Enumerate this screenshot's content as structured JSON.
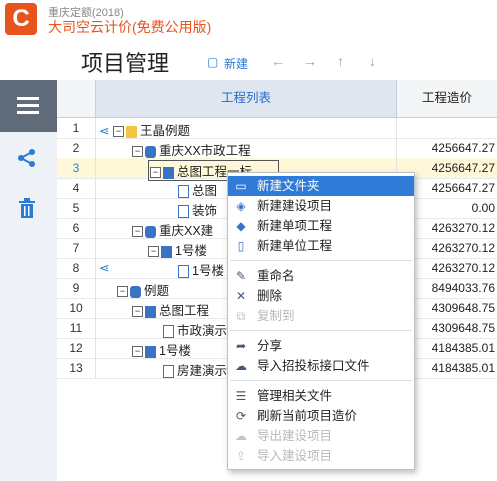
{
  "app": {
    "subtitle": "重庆定额(2018)",
    "title": "大司空云计价(免费公用版)",
    "logo_letter": "C"
  },
  "header": {
    "page_title": "项目管理",
    "new_label": "新建"
  },
  "grid": {
    "col_tree": "工程列表",
    "col_cost": "工程造价",
    "rows": [
      {
        "num": "1",
        "name": "王晶例题",
        "cost": ""
      },
      {
        "num": "2",
        "name": "重庆XX市政工程",
        "cost": "4256647.27"
      },
      {
        "num": "3",
        "name": "总图工程一标",
        "cost": "4256647.27"
      },
      {
        "num": "4",
        "name": "总图",
        "cost": "4256647.27"
      },
      {
        "num": "5",
        "name": "装饰",
        "cost": "0.00"
      },
      {
        "num": "6",
        "name": "重庆XX建",
        "cost": "4263270.12"
      },
      {
        "num": "7",
        "name": "1号楼",
        "cost": "4263270.12"
      },
      {
        "num": "8",
        "name": "1号楼",
        "cost": "4263270.12"
      },
      {
        "num": "9",
        "name": "例题",
        "cost": "8494033.76"
      },
      {
        "num": "10",
        "name": "总图工程",
        "cost": "4309648.75"
      },
      {
        "num": "11",
        "name": "市政演示",
        "cost": "4309648.75"
      },
      {
        "num": "12",
        "name": "1号楼",
        "cost": "4184385.01"
      },
      {
        "num": "13",
        "name": "房建演示",
        "cost": "4184385.01"
      }
    ]
  },
  "context_menu": {
    "items": [
      {
        "label": "新建文件夹",
        "icon": "folder-icon"
      },
      {
        "label": "新建建设项目",
        "icon": "cubes-icon"
      },
      {
        "label": "新建单项工程",
        "icon": "cube-icon"
      },
      {
        "label": "新建单位工程",
        "icon": "file-icon"
      },
      {
        "label": "重命名",
        "icon": "edit-icon"
      },
      {
        "label": "删除",
        "icon": "close-icon"
      },
      {
        "label": "复制到",
        "icon": "copy-icon"
      },
      {
        "label": "分享",
        "icon": "share-icon"
      },
      {
        "label": "导入招投标接口文件",
        "icon": "cloud-upload-icon"
      },
      {
        "label": "管理相关文件",
        "icon": "list-icon"
      },
      {
        "label": "刷新当前项目造价",
        "icon": "refresh-icon"
      },
      {
        "label": "导出建设项目",
        "icon": "cloud-download-icon"
      },
      {
        "label": "导入建设项目",
        "icon": "upload-icon"
      }
    ]
  },
  "colors": {
    "accent": "#e8541e",
    "blue": "#2a7ad6",
    "selected_row": "#fff8d8"
  }
}
